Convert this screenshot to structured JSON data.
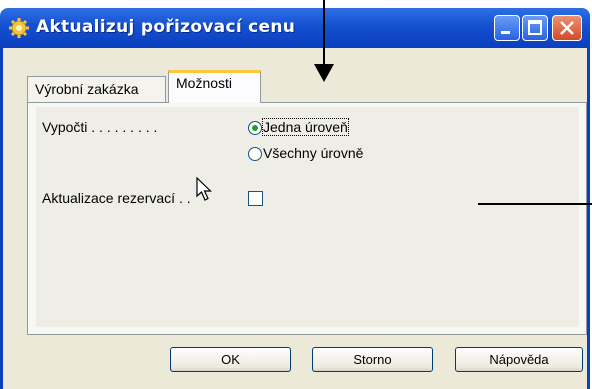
{
  "window": {
    "title": "Aktualizuj pořizovací cenu",
    "icon": "gear-icon"
  },
  "tabs": [
    {
      "label": "Výrobní zakázka",
      "selected": false
    },
    {
      "label": "Možnosti",
      "selected": true
    }
  ],
  "form": {
    "vypocti_label": "Vypočti . . . . . . . . .",
    "options": [
      {
        "label": "Jedna úroveň",
        "selected": true
      },
      {
        "label": "Všechny úrovně",
        "selected": false
      }
    ],
    "aktualizace_label": "Aktualizace rezervací . .",
    "aktualizace_checked": false
  },
  "buttons": {
    "ok": "OK",
    "storno": "Storno",
    "help": "Nápověda"
  },
  "colors": {
    "titlebar": "#0a3fbf",
    "dialog_bg": "#ece9d8",
    "tab_highlight": "#ffc83c",
    "radio_dot": "#21a121"
  }
}
